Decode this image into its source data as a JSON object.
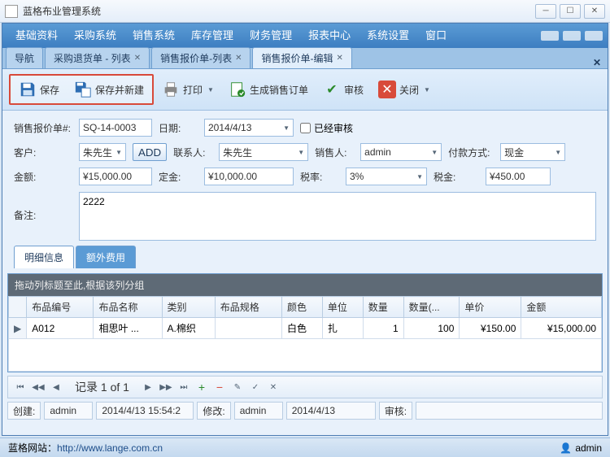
{
  "window": {
    "title": "蓝格布业管理系统"
  },
  "menu": [
    "基础资料",
    "采购系统",
    "销售系统",
    "库存管理",
    "财务管理",
    "报表中心",
    "系统设置",
    "窗口"
  ],
  "doctabs": {
    "items": [
      {
        "label": "导航"
      },
      {
        "label": "采购退货单 - 列表"
      },
      {
        "label": "销售报价单-列表"
      },
      {
        "label": "销售报价单-编辑",
        "active": true
      }
    ]
  },
  "toolbar": {
    "save": "保存",
    "save_new": "保存并新建",
    "print": "打印",
    "gen_order": "生成销售订单",
    "audit": "审核",
    "close": "关闭"
  },
  "form": {
    "quote_no_label": "销售报价单#:",
    "quote_no": "SQ-14-0003",
    "date_label": "日期:",
    "date": "2014/4/13",
    "audited_label": "已经审核",
    "customer_label": "客户:",
    "customer": "朱先生",
    "add_btn": "ADD",
    "contact_label": "联系人:",
    "contact": "朱先生",
    "salesman_label": "销售人:",
    "salesman": "admin",
    "pay_method_label": "付款方式:",
    "pay_method": "现金",
    "amount_label": "金额:",
    "amount": "¥15,000.00",
    "deposit_label": "定金:",
    "deposit": "¥10,000.00",
    "tax_rate_label": "税率:",
    "tax_rate": "3%",
    "tax_label": "税金:",
    "tax": "¥450.00",
    "remarks_label": "备注:",
    "remarks": "2222"
  },
  "detail_tabs": {
    "main": "明细信息",
    "extra": "额外费用"
  },
  "grid": {
    "group_hint": "拖动列标题至此,根据该列分组",
    "headers": [
      "布品编号",
      "布品名称",
      "类别",
      "布品规格",
      "颜色",
      "单位",
      "数量",
      "数量(...",
      "单价",
      "金额"
    ],
    "rows": [
      {
        "code": "A012",
        "name": "相思叶 ...",
        "category": "A.棉织",
        "spec": "",
        "color": "白色",
        "unit": "扎",
        "qty": "1",
        "qty2": "100",
        "price": "¥150.00",
        "amount": "¥15,000.00"
      }
    ]
  },
  "navigator": {
    "record_text": "记录 1 of 1"
  },
  "audit_bar": {
    "create_label": "创建:",
    "create_user": "admin",
    "create_time": "2014/4/13 15:54:2",
    "modify_label": "修改:",
    "modify_user": "admin",
    "modify_time": "2014/4/13",
    "audit_label": "审核:"
  },
  "status": {
    "site_label": "蓝格网站：",
    "site_url": "http://www.lange.com.cn",
    "user": "admin"
  }
}
